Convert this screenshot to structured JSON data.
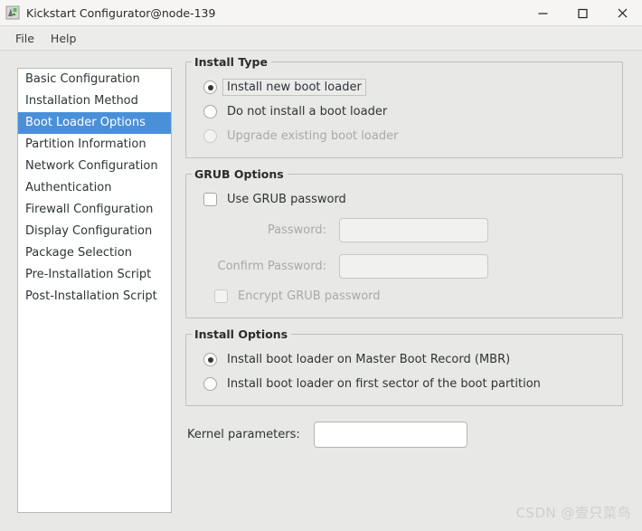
{
  "window": {
    "title": "Kickstart Configurator@node-139",
    "app_icon": "kickstart-app-icon",
    "controls": {
      "minimize": "minimize-icon",
      "maximize": "maximize-icon",
      "close": "close-icon"
    }
  },
  "menubar": {
    "items": [
      {
        "label": "File"
      },
      {
        "label": "Help"
      }
    ]
  },
  "sidebar": {
    "selected_index": 2,
    "selection_color": "#4a90d9",
    "items": [
      {
        "label": "Basic Configuration"
      },
      {
        "label": "Installation Method"
      },
      {
        "label": "Boot Loader Options"
      },
      {
        "label": "Partition Information"
      },
      {
        "label": "Network Configuration"
      },
      {
        "label": "Authentication"
      },
      {
        "label": "Firewall Configuration"
      },
      {
        "label": "Display Configuration"
      },
      {
        "label": "Package Selection"
      },
      {
        "label": "Pre-Installation Script"
      },
      {
        "label": "Post-Installation Script"
      }
    ]
  },
  "install_type": {
    "legend": "Install Type",
    "options": [
      {
        "label": "Install new boot loader",
        "checked": true,
        "disabled": false,
        "focused": true
      },
      {
        "label": "Do not install a boot loader",
        "checked": false,
        "disabled": false,
        "focused": false
      },
      {
        "label": "Upgrade existing boot loader",
        "checked": false,
        "disabled": true,
        "focused": false
      }
    ]
  },
  "grub_options": {
    "legend": "GRUB Options",
    "use_grub_password": {
      "label": "Use GRUB password",
      "checked": false,
      "disabled": false
    },
    "password": {
      "label": "Password:",
      "value": "",
      "placeholder": "",
      "disabled": true
    },
    "confirm_password": {
      "label": "Confirm Password:",
      "value": "",
      "placeholder": "",
      "disabled": true
    },
    "encrypt": {
      "label": "Encrypt GRUB password",
      "checked": false,
      "disabled": true
    }
  },
  "install_options": {
    "legend": "Install Options",
    "options": [
      {
        "label": "Install boot loader on Master Boot Record (MBR)",
        "checked": true,
        "disabled": false
      },
      {
        "label": "Install boot loader on first sector of the boot partition",
        "checked": false,
        "disabled": false
      }
    ]
  },
  "kernel_parameters": {
    "label": "Kernel parameters:",
    "value": "",
    "placeholder": ""
  },
  "watermark": {
    "text": "CSDN @壹只菜鸟"
  }
}
